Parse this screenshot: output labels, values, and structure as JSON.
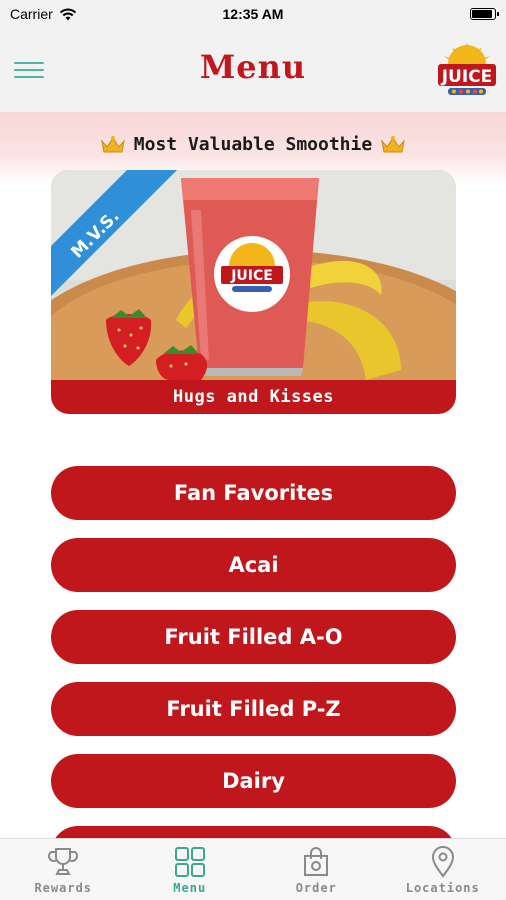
{
  "status_bar": {
    "carrier": "Carrier",
    "time": "12:35 AM",
    "battery_level": 0.95
  },
  "header": {
    "title": "Menu",
    "logo_text": "JUICE"
  },
  "banner": {
    "title": "Most Valuable Smoothie"
  },
  "featured": {
    "ribbon": "M.V.S.",
    "cup_logo": "JUICE",
    "name": "Hugs and Kisses"
  },
  "menu_items": [
    {
      "label": "Fan Favorites"
    },
    {
      "label": "Acai"
    },
    {
      "label": "Fruit Filled A-O"
    },
    {
      "label": "Fruit Filled P-Z"
    },
    {
      "label": "Dairy"
    },
    {
      "label": ""
    }
  ],
  "tabs": [
    {
      "label": "Rewards",
      "icon": "trophy-icon",
      "active": false
    },
    {
      "label": "Menu",
      "icon": "grid-icon",
      "active": true
    },
    {
      "label": "Order",
      "icon": "bag-icon",
      "active": false
    },
    {
      "label": "Locations",
      "icon": "map-pin-icon",
      "active": false
    }
  ],
  "colors": {
    "brand_red": "#c0171c",
    "accent_teal": "#3aa88f",
    "ribbon_blue": "#2f8fd8",
    "banner_pink": "#f9d6d6"
  }
}
